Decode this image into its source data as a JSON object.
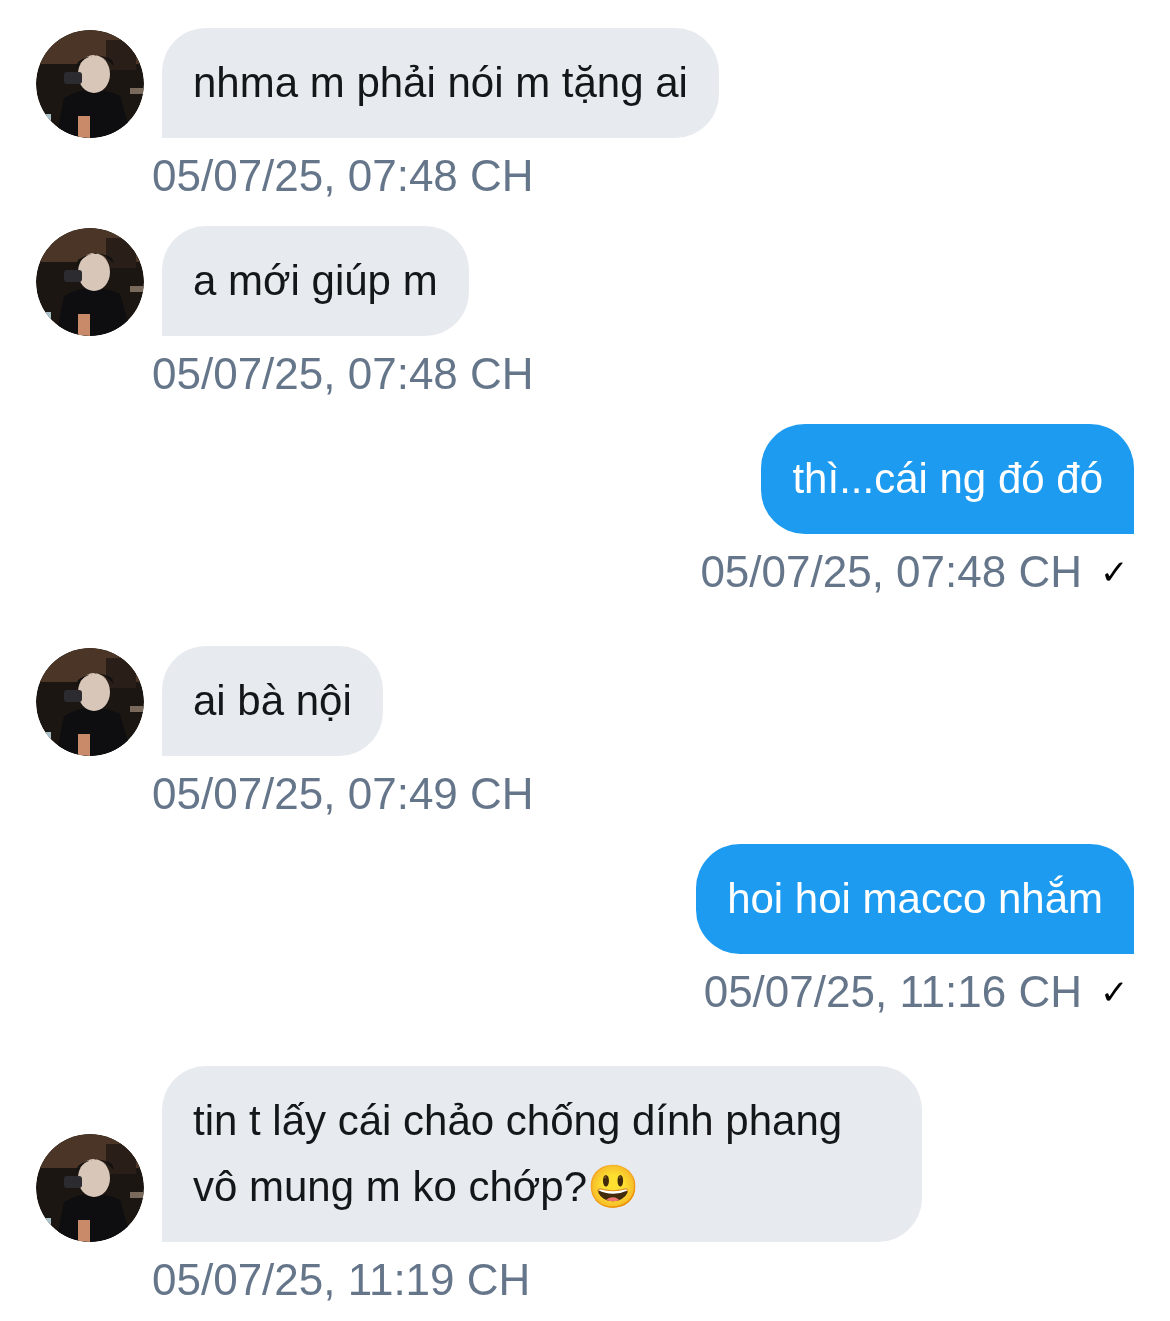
{
  "messages": [
    {
      "kind": "incoming",
      "text": "nhma m phải nói m tặng ai",
      "time": "05/07/25, 07:48 CH"
    },
    {
      "kind": "incoming",
      "text": "a mới giúp m",
      "time": "05/07/25, 07:48 CH"
    },
    {
      "kind": "outgoing",
      "text": "thì...cái ng đó đó",
      "time": "05/07/25, 07:48 CH",
      "status": "✓"
    },
    {
      "kind": "incoming",
      "text": "ai bà nội",
      "time": "05/07/25, 07:49 CH"
    },
    {
      "kind": "outgoing",
      "text": "hoi hoi macco nhắm",
      "time": "05/07/25, 11:16 CH",
      "status": "✓"
    },
    {
      "kind": "incoming",
      "text": "tin t lấy cái chảo chống dính phang vô mung m ko chớp?😃",
      "time": "05/07/25, 11:19 CH"
    }
  ]
}
